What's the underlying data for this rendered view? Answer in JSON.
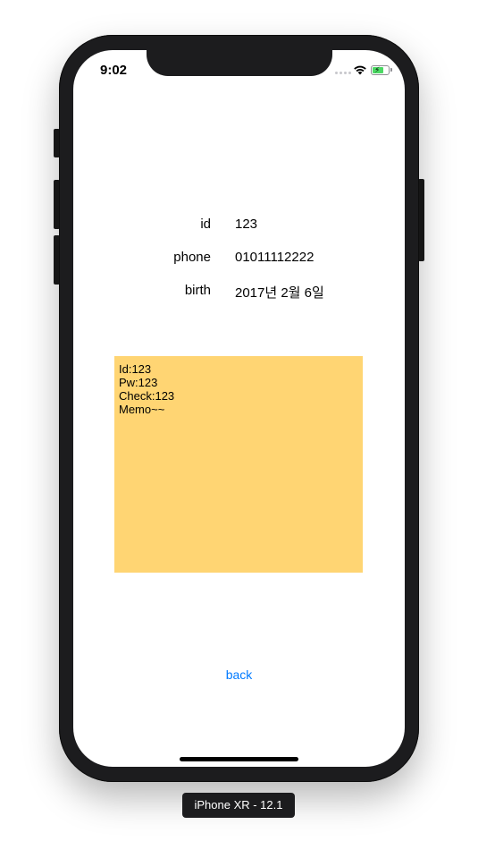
{
  "status_bar": {
    "time": "9:02"
  },
  "fields": [
    {
      "label": "id",
      "value": "123"
    },
    {
      "label": "phone",
      "value": "01011112222"
    },
    {
      "label": "birth",
      "value": "2017년 2월 6일"
    }
  ],
  "memo": {
    "text": "Id:123\nPw:123\nCheck:123\nMemo~~",
    "background": "#ffd573"
  },
  "back_button": {
    "label": "back",
    "color": "#007aff"
  },
  "device_label": "iPhone XR - 12.1"
}
